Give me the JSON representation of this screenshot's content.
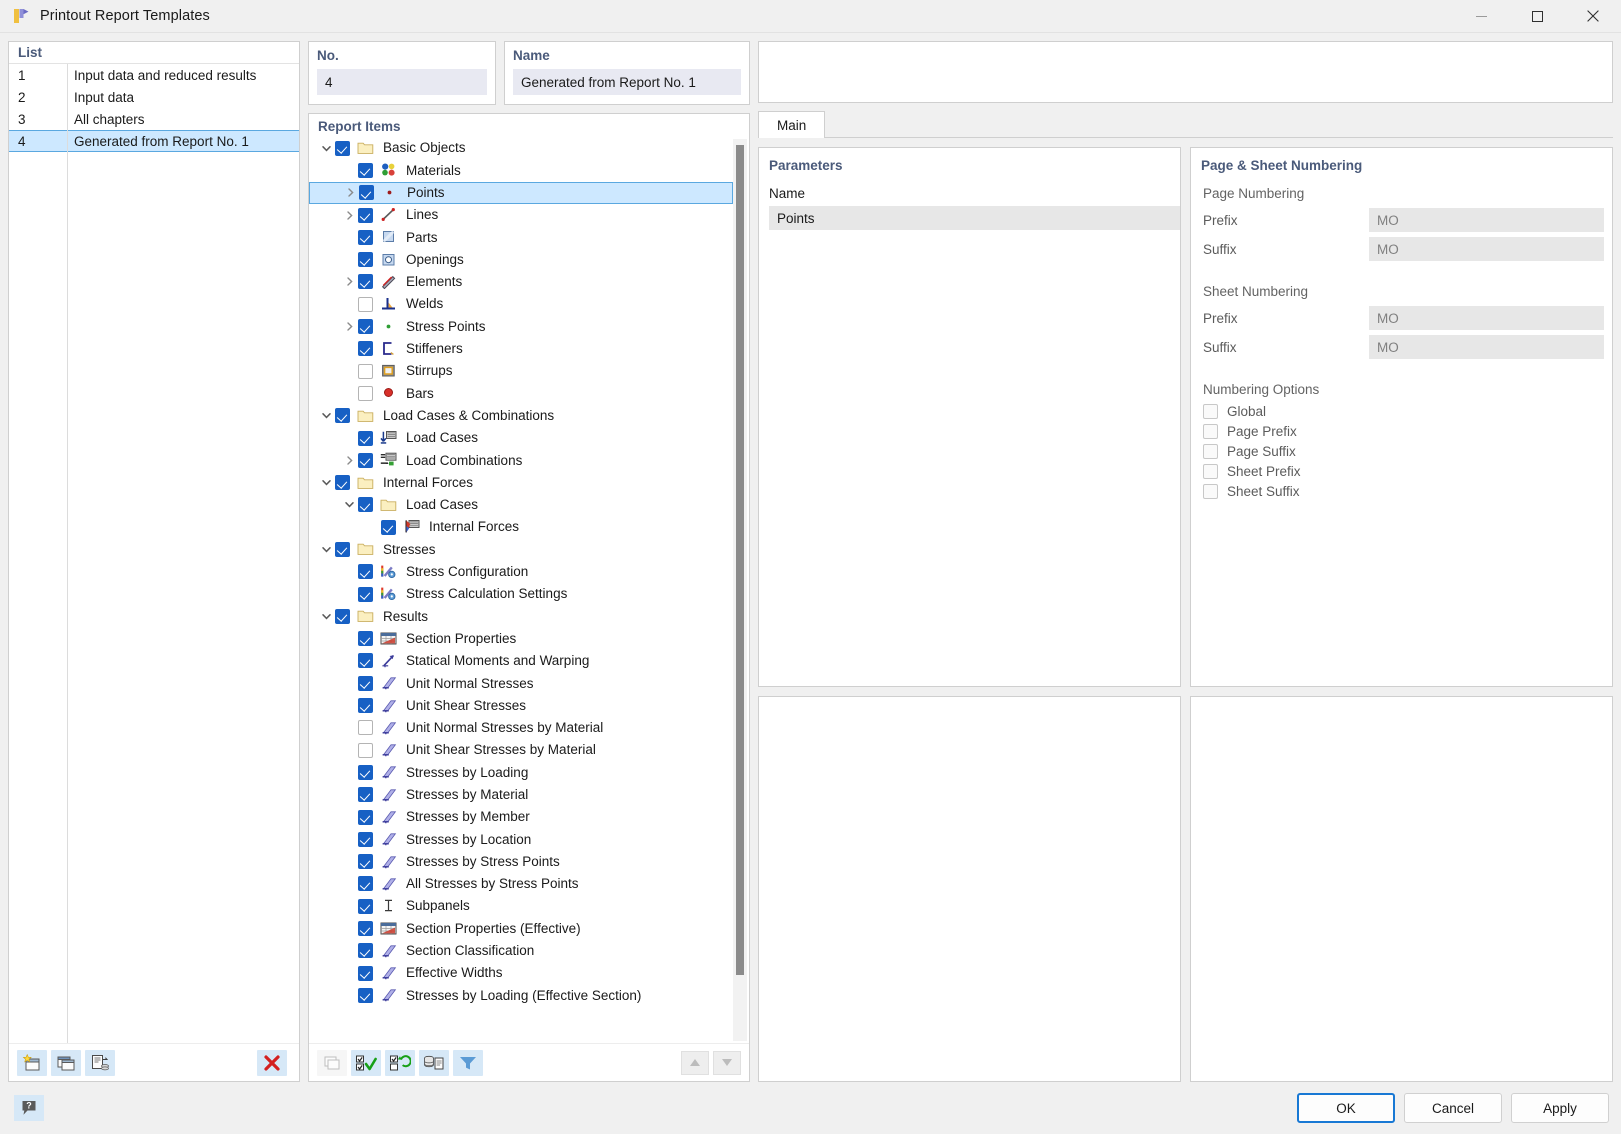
{
  "window": {
    "title": "Printout Report Templates",
    "icon": "report-template-icon",
    "minimize": "minimize-icon",
    "maximize": "maximize-icon",
    "close": "close-icon"
  },
  "list_panel": {
    "header": "List",
    "rows": [
      {
        "no": "1",
        "name": "Input data and reduced results",
        "selected": false
      },
      {
        "no": "2",
        "name": "Input data",
        "selected": false
      },
      {
        "no": "3",
        "name": "All chapters",
        "selected": false
      },
      {
        "no": "4",
        "name": "Generated from Report No. 1",
        "selected": true
      }
    ],
    "toolbar": [
      {
        "name": "new-template-button",
        "icon": "new-window-star-icon",
        "enabled": true
      },
      {
        "name": "copy-template-button",
        "icon": "copy-window-icon",
        "enabled": true
      },
      {
        "name": "import-template-button",
        "icon": "document-database-icon",
        "enabled": true
      },
      {
        "name": "delete-template-button",
        "icon": "red-x-icon",
        "enabled": true
      }
    ]
  },
  "no_field": {
    "label": "No.",
    "value": "4"
  },
  "name_field": {
    "label": "Name",
    "value": "Generated from Report No. 1"
  },
  "report_items": {
    "header": "Report Items",
    "tree": [
      {
        "label": "Basic Objects",
        "depth": 0,
        "twist": "down",
        "checked": true,
        "icon": "folder-icon",
        "selected": false
      },
      {
        "label": "Materials",
        "depth": 1,
        "twist": "none",
        "checked": true,
        "icon": "materials-icon",
        "selected": false
      },
      {
        "label": "Points",
        "depth": 1,
        "twist": "right",
        "checked": true,
        "icon": "point-icon",
        "selected": true
      },
      {
        "label": "Lines",
        "depth": 1,
        "twist": "right",
        "checked": true,
        "icon": "line-icon",
        "selected": false
      },
      {
        "label": "Parts",
        "depth": 1,
        "twist": "none",
        "checked": true,
        "icon": "part-icon",
        "selected": false
      },
      {
        "label": "Openings",
        "depth": 1,
        "twist": "none",
        "checked": true,
        "icon": "opening-icon",
        "selected": false
      },
      {
        "label": "Elements",
        "depth": 1,
        "twist": "right",
        "checked": true,
        "icon": "element-icon",
        "selected": false
      },
      {
        "label": "Welds",
        "depth": 1,
        "twist": "none",
        "checked": false,
        "icon": "weld-icon",
        "selected": false
      },
      {
        "label": "Stress Points",
        "depth": 1,
        "twist": "right",
        "checked": true,
        "icon": "stress-point-icon",
        "selected": false
      },
      {
        "label": "Stiffeners",
        "depth": 1,
        "twist": "none",
        "checked": true,
        "icon": "stiffener-icon",
        "selected": false
      },
      {
        "label": "Stirrups",
        "depth": 1,
        "twist": "none",
        "checked": false,
        "icon": "stirrup-icon",
        "selected": false
      },
      {
        "label": "Bars",
        "depth": 1,
        "twist": "none",
        "checked": false,
        "icon": "bar-icon",
        "selected": false
      },
      {
        "label": "Load Cases & Combinations",
        "depth": 0,
        "twist": "down",
        "checked": true,
        "icon": "folder-icon",
        "selected": false
      },
      {
        "label": "Load Cases",
        "depth": 1,
        "twist": "none",
        "checked": true,
        "icon": "load-case-icon",
        "selected": false
      },
      {
        "label": "Load Combinations",
        "depth": 1,
        "twist": "right",
        "checked": true,
        "icon": "load-combination-icon",
        "selected": false
      },
      {
        "label": "Internal Forces",
        "depth": 0,
        "twist": "down",
        "checked": true,
        "icon": "folder-icon",
        "selected": false
      },
      {
        "label": "Load Cases",
        "depth": 1,
        "twist": "down",
        "checked": true,
        "icon": "folder-icon",
        "selected": false
      },
      {
        "label": "Internal Forces",
        "depth": 2,
        "twist": "none",
        "checked": true,
        "icon": "internal-forces-icon",
        "selected": false
      },
      {
        "label": "Stresses",
        "depth": 0,
        "twist": "down",
        "checked": true,
        "icon": "folder-icon",
        "selected": false
      },
      {
        "label": "Stress Configuration",
        "depth": 1,
        "twist": "none",
        "checked": true,
        "icon": "stress-config-icon",
        "selected": false
      },
      {
        "label": "Stress Calculation Settings",
        "depth": 1,
        "twist": "none",
        "checked": true,
        "icon": "stress-config-icon",
        "selected": false
      },
      {
        "label": "Results",
        "depth": 0,
        "twist": "down",
        "checked": true,
        "icon": "folder-icon",
        "selected": false
      },
      {
        "label": "Section Properties",
        "depth": 1,
        "twist": "none",
        "checked": true,
        "icon": "table-icon",
        "selected": false
      },
      {
        "label": "Statical Moments and Warping",
        "depth": 1,
        "twist": "none",
        "checked": true,
        "icon": "beam-arrow-icon",
        "selected": false
      },
      {
        "label": "Unit Normal Stresses",
        "depth": 1,
        "twist": "none",
        "checked": true,
        "icon": "beam-icon",
        "selected": false
      },
      {
        "label": "Unit Shear Stresses",
        "depth": 1,
        "twist": "none",
        "checked": true,
        "icon": "beam-icon",
        "selected": false
      },
      {
        "label": "Unit Normal Stresses by Material",
        "depth": 1,
        "twist": "none",
        "checked": false,
        "icon": "beam-icon",
        "selected": false
      },
      {
        "label": "Unit Shear Stresses by Material",
        "depth": 1,
        "twist": "none",
        "checked": false,
        "icon": "beam-icon",
        "selected": false
      },
      {
        "label": "Stresses by Loading",
        "depth": 1,
        "twist": "none",
        "checked": true,
        "icon": "beam-icon",
        "selected": false
      },
      {
        "label": "Stresses by Material",
        "depth": 1,
        "twist": "none",
        "checked": true,
        "icon": "beam-icon",
        "selected": false
      },
      {
        "label": "Stresses by Member",
        "depth": 1,
        "twist": "none",
        "checked": true,
        "icon": "beam-icon",
        "selected": false
      },
      {
        "label": "Stresses by Location",
        "depth": 1,
        "twist": "none",
        "checked": true,
        "icon": "beam-icon",
        "selected": false
      },
      {
        "label": "Stresses by Stress Points",
        "depth": 1,
        "twist": "none",
        "checked": true,
        "icon": "beam-icon",
        "selected": false
      },
      {
        "label": "All Stresses by Stress Points",
        "depth": 1,
        "twist": "none",
        "checked": true,
        "icon": "beam-icon",
        "selected": false
      },
      {
        "label": "Subpanels",
        "depth": 1,
        "twist": "none",
        "checked": true,
        "icon": "subpanel-icon",
        "selected": false
      },
      {
        "label": "Section Properties (Effective)",
        "depth": 1,
        "twist": "none",
        "checked": true,
        "icon": "table-icon",
        "selected": false
      },
      {
        "label": "Section Classification",
        "depth": 1,
        "twist": "none",
        "checked": true,
        "icon": "beam-icon",
        "selected": false
      },
      {
        "label": "Effective Widths",
        "depth": 1,
        "twist": "none",
        "checked": true,
        "icon": "beam-icon",
        "selected": false
      },
      {
        "label": "Stresses by Loading (Effective Section)",
        "depth": 1,
        "twist": "none",
        "checked": true,
        "icon": "beam-icon",
        "selected": false
      }
    ],
    "toolbar": [
      {
        "name": "duplicate-item-button",
        "icon": "copy-window-icon",
        "enabled": false
      },
      {
        "name": "select-all-button",
        "icon": "check-all-icon",
        "enabled": true
      },
      {
        "name": "invert-selection-button",
        "icon": "toggle-selection-icon",
        "enabled": true
      },
      {
        "name": "load-from-database-button",
        "icon": "database-document-icon",
        "enabled": true
      },
      {
        "name": "filter-button",
        "icon": "funnel-icon",
        "enabled": true
      },
      {
        "name": "move-up-button",
        "icon": "arrow-up-icon",
        "enabled": false
      },
      {
        "name": "move-down-button",
        "icon": "arrow-down-icon",
        "enabled": false
      }
    ]
  },
  "tabs": [
    {
      "label": "Main",
      "active": true
    }
  ],
  "parameters": {
    "title": "Parameters",
    "name_label": "Name",
    "name_value": "Points"
  },
  "numbering": {
    "title": "Page & Sheet Numbering",
    "page_group": "Page Numbering",
    "page_fields": [
      {
        "label": "Prefix",
        "value": "MO"
      },
      {
        "label": "Suffix",
        "value": "MO"
      }
    ],
    "sheet_group": "Sheet Numbering",
    "sheet_fields": [
      {
        "label": "Prefix",
        "value": "MO"
      },
      {
        "label": "Suffix",
        "value": "MO"
      }
    ],
    "options_group": "Numbering Options",
    "options": [
      {
        "label": "Global",
        "checked": false
      },
      {
        "label": "Page Prefix",
        "checked": false
      },
      {
        "label": "Page Suffix",
        "checked": false
      },
      {
        "label": "Sheet Prefix",
        "checked": false
      },
      {
        "label": "Sheet Suffix",
        "checked": false
      }
    ]
  },
  "footer": {
    "help": "help-icon",
    "ok": "OK",
    "cancel": "Cancel",
    "apply": "Apply"
  },
  "colors": {
    "accent": "#1760c4",
    "selection": "#cde8ff",
    "heading": "#4a5a7a",
    "field_bg": "#e8e9f2",
    "danger": "#d32020"
  }
}
